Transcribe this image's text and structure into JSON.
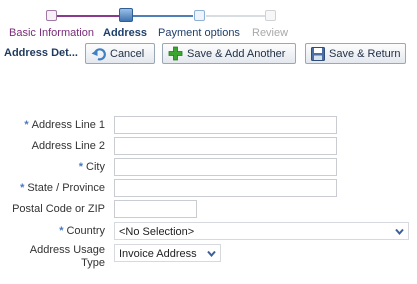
{
  "train": {
    "steps": [
      {
        "label": "Basic Information",
        "state": "visited"
      },
      {
        "label": "Address",
        "state": "current"
      },
      {
        "label": "Payment options",
        "state": "next"
      },
      {
        "label": "Review",
        "state": "disabled"
      }
    ]
  },
  "header": {
    "title": "Address Det...",
    "buttons": {
      "cancel": "Cancel",
      "save_add_another": "Save & Add Another",
      "save_return": "Save & Return"
    }
  },
  "form": {
    "address_line_1": {
      "label": "Address Line 1",
      "required": true,
      "value": ""
    },
    "address_line_2": {
      "label": "Address Line 2",
      "required": false,
      "value": ""
    },
    "city": {
      "label": "City",
      "required": true,
      "value": ""
    },
    "state_province": {
      "label": "State / Province",
      "required": true,
      "value": ""
    },
    "postal_code": {
      "label": "Postal Code or ZIP",
      "required": false,
      "value": ""
    },
    "country": {
      "label": "Country",
      "required": true,
      "value": "<No Selection>"
    },
    "address_usage_type": {
      "label_line1": "Address Usage",
      "label_line2": "Type",
      "value": "Invoice Address"
    },
    "required_marker": "*"
  },
  "colors": {
    "required_marker": "#4a78c0",
    "train_visited": "#8a3a8c",
    "train_current": "#1f3f6b",
    "train_disabled": "#a8a8a8"
  },
  "icons": {
    "cancel": "undo-arrow-icon",
    "save_add_another": "plus-icon",
    "save_return": "floppy-disk-icon",
    "dropdown": "chevron-down-icon"
  }
}
